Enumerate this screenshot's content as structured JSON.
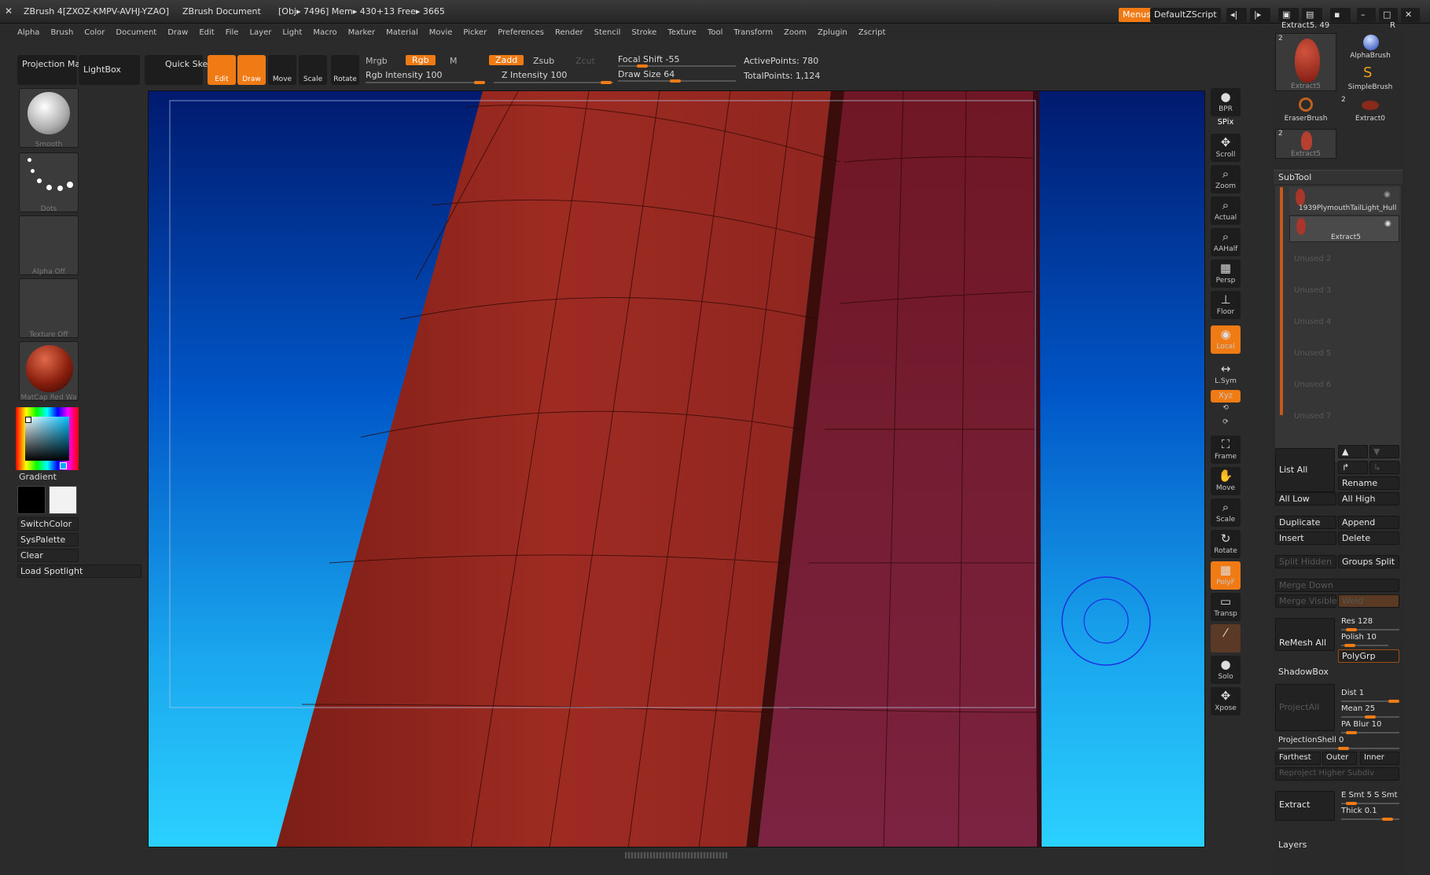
{
  "title": {
    "app": "ZBrush 4[ZXOZ-KMPV-AVHJ-YZAO]",
    "doc": "ZBrush Document",
    "stats": "[Obj▸ 7496] Mem▸ 430+13 Free▸ 3665"
  },
  "top_right": {
    "menus": "Menus",
    "script": "DefaultZScript"
  },
  "menu": [
    "Alpha",
    "Brush",
    "Color",
    "Document",
    "Draw",
    "Edit",
    "File",
    "Layer",
    "Light",
    "Macro",
    "Marker",
    "Material",
    "Movie",
    "Picker",
    "Preferences",
    "Render",
    "Stencil",
    "Stroke",
    "Texture",
    "Tool",
    "Transform",
    "Zoom",
    "Zplugin",
    "Zscript"
  ],
  "toolbar": {
    "projection_master": "Projection Master",
    "lightbox": "LightBox",
    "quick_sketch": "Quick Sketch",
    "edit": "Edit",
    "draw": "Draw",
    "move": "Move",
    "scale": "Scale",
    "rotate": "Rotate",
    "mrgb": "Mrgb",
    "rgb": "Rgb",
    "m": "M",
    "zadd": "Zadd",
    "zsub": "Zsub",
    "zcut": "Zcut",
    "rgb_intensity": "Rgb Intensity 100",
    "z_intensity": "Z Intensity 100",
    "focal_shift": "Focal Shift -55",
    "draw_size": "Draw Size 64",
    "active_points": "ActivePoints: 780",
    "total_points": "TotalPoints: 1,124"
  },
  "left": {
    "brush": "Smooth",
    "stroke": "Dots",
    "alpha": "Alpha Off",
    "texture": "Texture Off",
    "material": "MatCap Red Wa",
    "gradient": "Gradient",
    "switch_color": "SwitchColor",
    "sys_palette": "SysPalette",
    "clear": "Clear",
    "load_spotlight": "Load Spotlight"
  },
  "right_shelf": [
    "BPR",
    "SPix",
    "Scroll",
    "Zoom",
    "Actual",
    "AAHalf",
    "Persp",
    "Floor",
    "Local",
    "L.Sym",
    "Xyz",
    "",
    "",
    "Frame",
    "Move",
    "Scale",
    "Rotate",
    "PolyF",
    "Transp",
    "",
    "Solo",
    "Xpose"
  ],
  "tool_panel": {
    "header": "Extract5. 49",
    "r": "R",
    "tools": [
      {
        "name": "Extract5",
        "count": "2"
      },
      {
        "name": "AlphaBrush",
        "count": ""
      },
      {
        "name": "SimpleBrush",
        "count": ""
      },
      {
        "name": "EraserBrush",
        "count": ""
      },
      {
        "name": "Extract0",
        "count": "2"
      },
      {
        "name": "Extract5",
        "count": "2"
      }
    ]
  },
  "subtool": {
    "title": "SubTool",
    "items": [
      "1939PlymouthTailLight_Hull",
      "Extract5"
    ],
    "unused": [
      "Unused 2",
      "Unused 3",
      "Unused 4",
      "Unused 5",
      "Unused 6",
      "Unused 7"
    ],
    "list_all": "List All",
    "rename": "Rename",
    "all_low": "All Low",
    "all_high": "All High",
    "duplicate": "Duplicate",
    "append": "Append",
    "insert": "Insert",
    "delete": "Delete",
    "split_hidden": "Split Hidden",
    "groups_split": "Groups Split",
    "merge_down": "Merge Down",
    "merge_visible": "Merge Visible",
    "weld": "Weld",
    "remesh_all": "ReMesh All",
    "res": "Res 128",
    "polish": "Polish 10",
    "polygrp": "PolyGrp",
    "shadowbox": "ShadowBox",
    "project_all": "ProjectAll",
    "dist": "Dist 1",
    "mean": "Mean 25",
    "pa_blur": "PA Blur 10",
    "projection_shell": "ProjectionShell 0",
    "farthest": "Farthest",
    "outer": "Outer",
    "inner": "Inner",
    "reproject": "Reproject Higher Subdiv",
    "extract": "Extract",
    "e_smt": "E Smt 5",
    "s_smt": "S Smt",
    "thick": "Thick 0.1",
    "layers": "Layers"
  }
}
